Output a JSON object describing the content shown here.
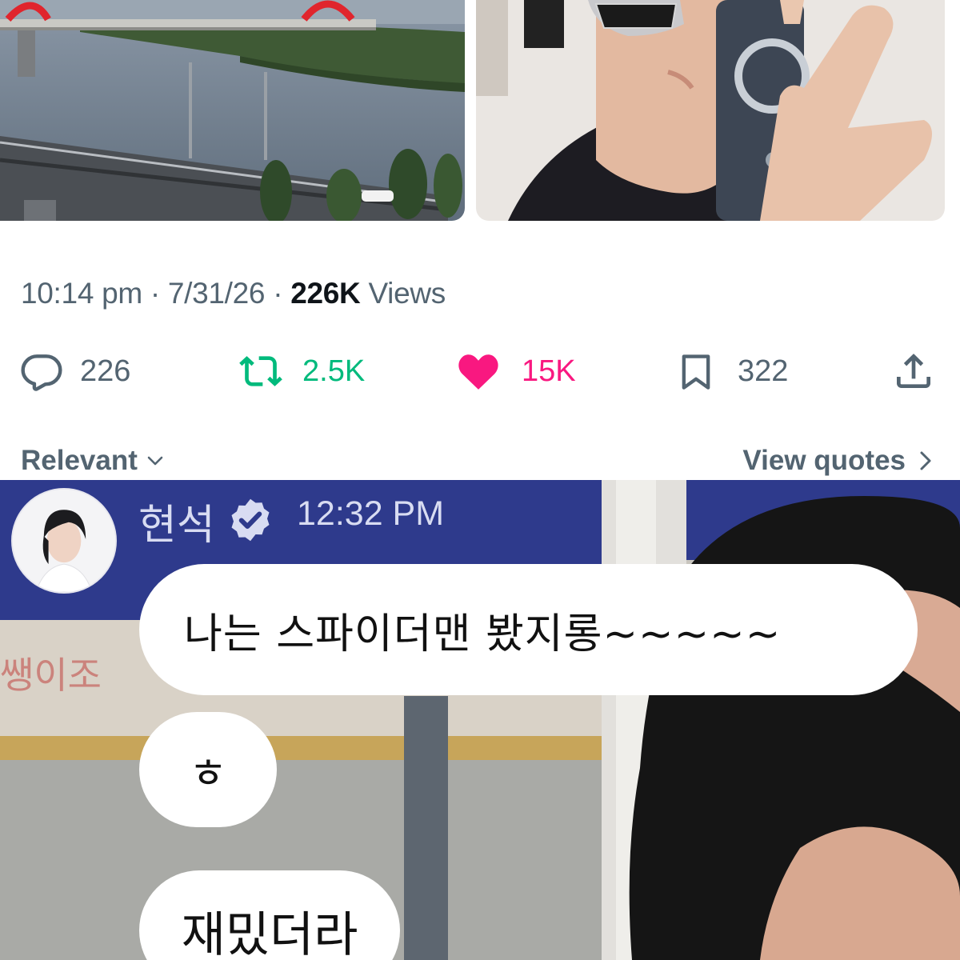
{
  "media": [
    {
      "icon": "bridge-river-photo"
    },
    {
      "icon": "selfie-phone-case-photo"
    }
  ],
  "meta": {
    "time": "10:14 pm",
    "separator": " · ",
    "date": "7/31/26",
    "views_count": "226K",
    "views_label": "Views"
  },
  "actions": {
    "replies": "226",
    "reposts": "2.5K",
    "likes": "15K",
    "bookmarks": "322"
  },
  "colors": {
    "muted": "#536471",
    "repost": "#00ba7c",
    "like": "#f91880",
    "chat_banner": "#2e3a8c"
  },
  "sort": {
    "label": "Relevant",
    "quotes_label": "View quotes"
  },
  "reply_photo": {
    "sender": "현석",
    "time": "12:32 PM",
    "messages": [
      "나는 스파이더맨 봤지롱~~~~~",
      "ㅎ",
      "재밌더라"
    ]
  }
}
